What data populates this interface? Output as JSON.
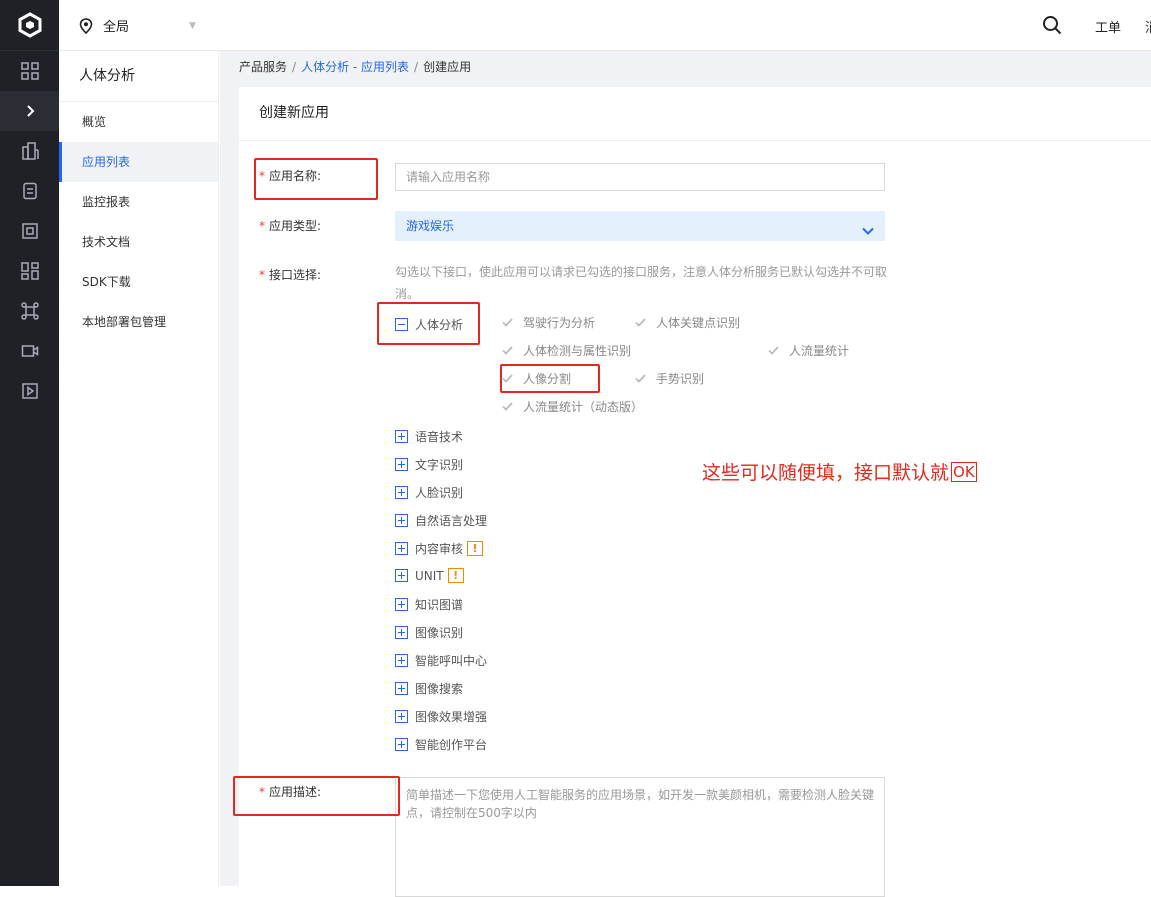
{
  "topbar": {
    "location": "全局",
    "ticket": "工单",
    "more": "消"
  },
  "rail": {
    "icons": [
      "logo-icon",
      "grid-icon",
      "chevron-right-icon",
      "building-icon",
      "document-icon",
      "frame-icon",
      "apps-icon",
      "network-icon",
      "video-icon",
      "play-icon"
    ]
  },
  "subnav": {
    "title": "人体分析",
    "items": [
      {
        "label": "概览"
      },
      {
        "label": "应用列表"
      },
      {
        "label": "监控报表"
      },
      {
        "label": "技术文档"
      },
      {
        "label": "SDK下载"
      },
      {
        "label": "本地部署包管理"
      }
    ]
  },
  "breadcrumb": {
    "root": "产品服务",
    "parent": "人体分析 - 应用列表",
    "current": "创建应用"
  },
  "form": {
    "title": "创建新应用",
    "name_label": "应用名称:",
    "name_placeholder": "请输入应用名称",
    "type_label": "应用类型:",
    "type_value": "游戏娱乐",
    "api_label": "接口选择:",
    "api_hint": "勾选以下接口，使此应用可以请求已勾选的接口服务，注意人体分析服务已默认勾选并不可取消。",
    "body_group": "人体分析",
    "body_apis": [
      "驾驶行为分析",
      "人体关键点识别",
      "人体检测与属性识别",
      "人流量统计",
      "人像分割",
      "手势识别",
      "人流量统计（动态版）"
    ],
    "groups": [
      "语音技术",
      "文字识别",
      "人脸识别",
      "自然语言处理",
      "内容审核",
      "UNIT",
      "知识图谱",
      "图像识别",
      "智能呼叫中心",
      "图像搜索",
      "图像效果增强",
      "智能创作平台"
    ],
    "desc_label": "应用描述:",
    "desc_placeholder": "简单描述一下您使用人工智能服务的应用场景，如开发一款美颜相机，需要检测人脸关键点，请控制在500字以内"
  },
  "annotation": {
    "note": "这些可以随便填，接口默认就",
    "ok": "OK"
  },
  "colors": {
    "accent": "#2468f2",
    "annotation_red": "#e5281e",
    "warning": "#f08c00"
  }
}
